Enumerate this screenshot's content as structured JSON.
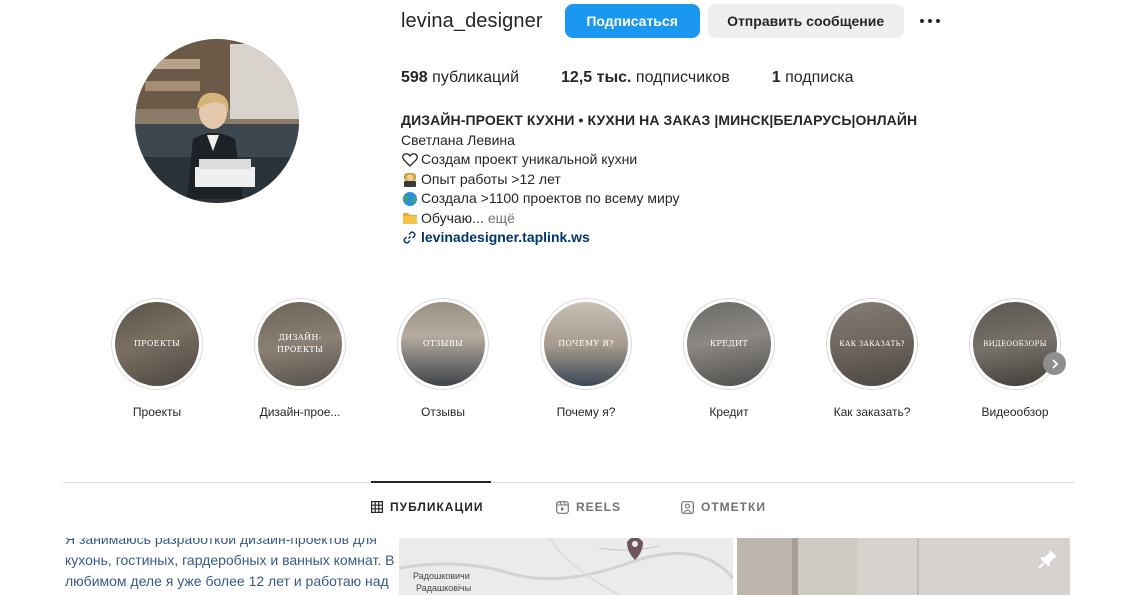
{
  "profile": {
    "username": "levina_designer",
    "follow_label": "Подписаться",
    "message_label": "Отправить сообщение",
    "more_icon": "more-horizontal-icon"
  },
  "stats": {
    "posts_count": "598",
    "posts_label": "публикаций",
    "followers_count": "12,5 тыс.",
    "followers_label": "подписчиков",
    "following_count": "1",
    "following_label": "подписка"
  },
  "bio": {
    "headline": "ДИЗАЙН-ПРОЕКТ КУХНИ • КУХНИ НА ЗАКАЗ |МИНСК|БЕЛАРУСЬ|ОНЛАЙН",
    "name": "Светлана Левина",
    "lines": [
      {
        "icon": "heart-outline-icon",
        "text": "Создам проект уникальной кухни"
      },
      {
        "icon": "judge-emoji-icon",
        "text": "Опыт работы >12 лет"
      },
      {
        "icon": "globe-emoji-icon",
        "text": "Создала >1100 проектов по всему миру"
      },
      {
        "icon": "folder-emoji-icon",
        "text": "Обучаю..."
      }
    ],
    "more_label": "ещё",
    "link_icon": "link-icon",
    "link": "levinadesigner.taplink.ws"
  },
  "highlights": [
    {
      "label": "Проекты",
      "caption": "ПРОЕКТЫ"
    },
    {
      "label": "Дизайн-прое...",
      "caption": "ДИЗАЙН-ПРОЕКТЫ"
    },
    {
      "label": "Отзывы",
      "caption": "ОТЗЫВЫ"
    },
    {
      "label": "Почему я?",
      "caption": "ПОЧЕМУ Я?"
    },
    {
      "label": "Кредит",
      "caption": "КРЕДИТ"
    },
    {
      "label": "Как заказать?",
      "caption": "КАК ЗАКАЗАТЬ?"
    },
    {
      "label": "Видеообзор",
      "caption": "ВИДЕООБЗОРЫ"
    }
  ],
  "tabs": [
    {
      "label": "ПУБЛИКАЦИИ",
      "icon": "grid-icon",
      "active": true
    },
    {
      "label": "REELS",
      "icon": "reels-icon",
      "active": false
    },
    {
      "label": "ОТМЕТКИ",
      "icon": "tagged-icon",
      "active": false
    }
  ],
  "posts": {
    "post1_text": "Я занимаюсь разработкой дизайн-проектов для кухонь, гостиных, гардеробных и ванных комнат. В любимом деле я уже более 12 лет и работаю над проектами в разных уголках",
    "post2_map_label_1": "Радошковичи",
    "post2_map_label_2": "Радашковічы",
    "post3_icon": "pin-icon"
  },
  "colors": {
    "accent": "#0095f6",
    "link": "#00376b",
    "text": "#262626",
    "muted": "#737373"
  }
}
